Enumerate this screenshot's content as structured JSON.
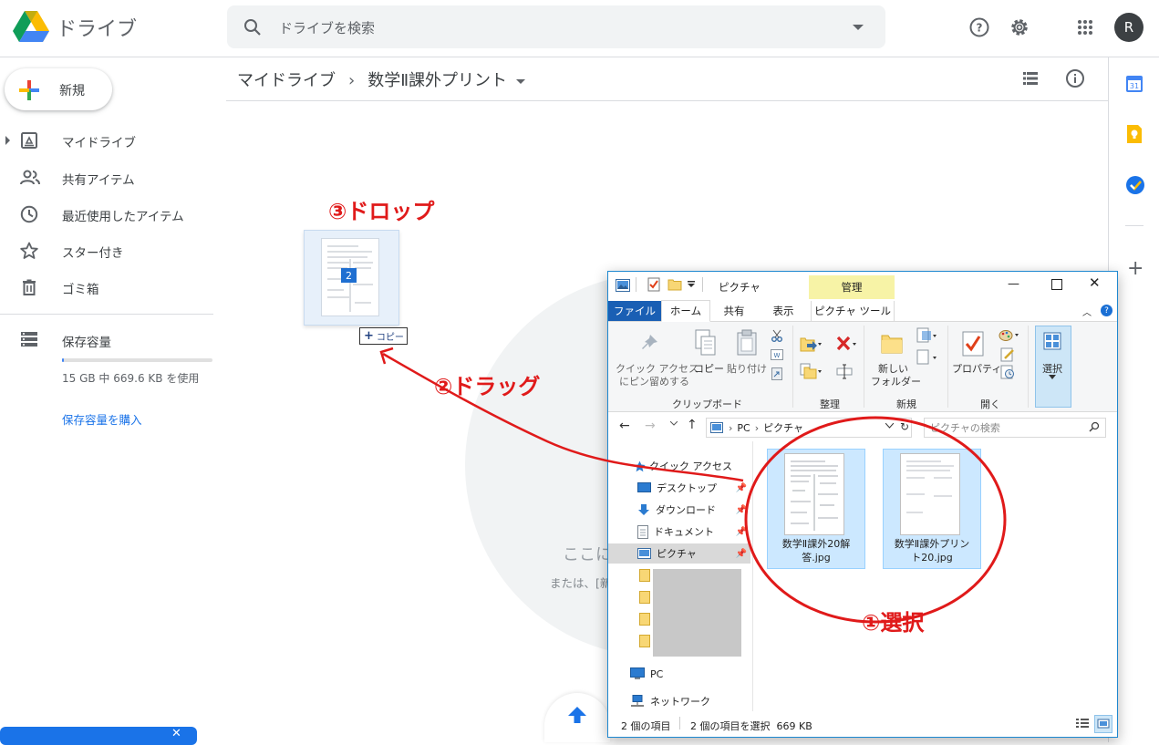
{
  "header": {
    "brand": "ドライブ",
    "search_placeholder": "ドライブを検索",
    "avatar_letter": "R"
  },
  "sidebar": {
    "new_label": "新規",
    "items": [
      {
        "label": "マイドライブ",
        "icon": "drive-icon"
      },
      {
        "label": "共有アイテム",
        "icon": "people-icon"
      },
      {
        "label": "最近使用したアイテム",
        "icon": "clock-icon"
      },
      {
        "label": "スター付き",
        "icon": "star-icon"
      },
      {
        "label": "ゴミ箱",
        "icon": "trash-icon"
      }
    ],
    "storage_label": "保存容量",
    "storage_text": "15 GB 中 669.6 KB を使用",
    "storage_used_fraction": 0.01,
    "buy_storage": "保存容量を購入"
  },
  "main": {
    "breadcrumb_root": "マイドライブ",
    "breadcrumb_sep": "›",
    "breadcrumb_folder": "数学Ⅱ課外プリント",
    "empty_title": "ここに",
    "empty_sub": "または、[新",
    "drop_badge": "2",
    "copy_label": "コピー"
  },
  "annotations": {
    "drop": "③ドロップ",
    "drag": "②ドラッグ",
    "select": "①選択"
  },
  "explorer": {
    "title": "ピクチャ",
    "manage_tab": "管理",
    "tabs": [
      "ファイル",
      "ホーム",
      "共有",
      "表示",
      "ピクチャ ツール"
    ],
    "ribbon": {
      "pin_label_1": "クイック アクセス",
      "pin_label_2": "にピン留めする",
      "copy": "コピー",
      "paste": "貼り付け",
      "group_clipboard": "クリップボード",
      "group_organize": "整理",
      "new_folder_1": "新しい",
      "new_folder_2": "フォルダー",
      "group_new": "新規",
      "properties": "プロパティ",
      "group_open": "開く",
      "select": "選択"
    },
    "address": [
      "PC",
      "ピクチャ"
    ],
    "search_placeholder": "ピクチャの検索",
    "nav": [
      {
        "label": "クイック アクセス",
        "icon": "star-icon"
      },
      {
        "label": "デスクトップ",
        "icon": "desktop-icon"
      },
      {
        "label": "ダウンロード",
        "icon": "download-icon"
      },
      {
        "label": "ドキュメント",
        "icon": "document-icon"
      },
      {
        "label": "ピクチャ",
        "icon": "pictures-icon"
      },
      {
        "label": "PC",
        "icon": "pc-icon"
      },
      {
        "label": "ネットワーク",
        "icon": "network-icon"
      }
    ],
    "files": [
      {
        "name_1": "数学Ⅱ課外20解",
        "name_2": "答.jpg"
      },
      {
        "name_1": "数学Ⅱ課外プリン",
        "name_2": "ト20.jpg"
      }
    ],
    "status_count": "2 個の項目",
    "status_selected": "2 個の項目を選択  669 KB"
  },
  "colors": {
    "drive_blue": "#1a73e8",
    "annotation_red": "#e01a1a",
    "explorer_selection": "#cce8ff"
  }
}
